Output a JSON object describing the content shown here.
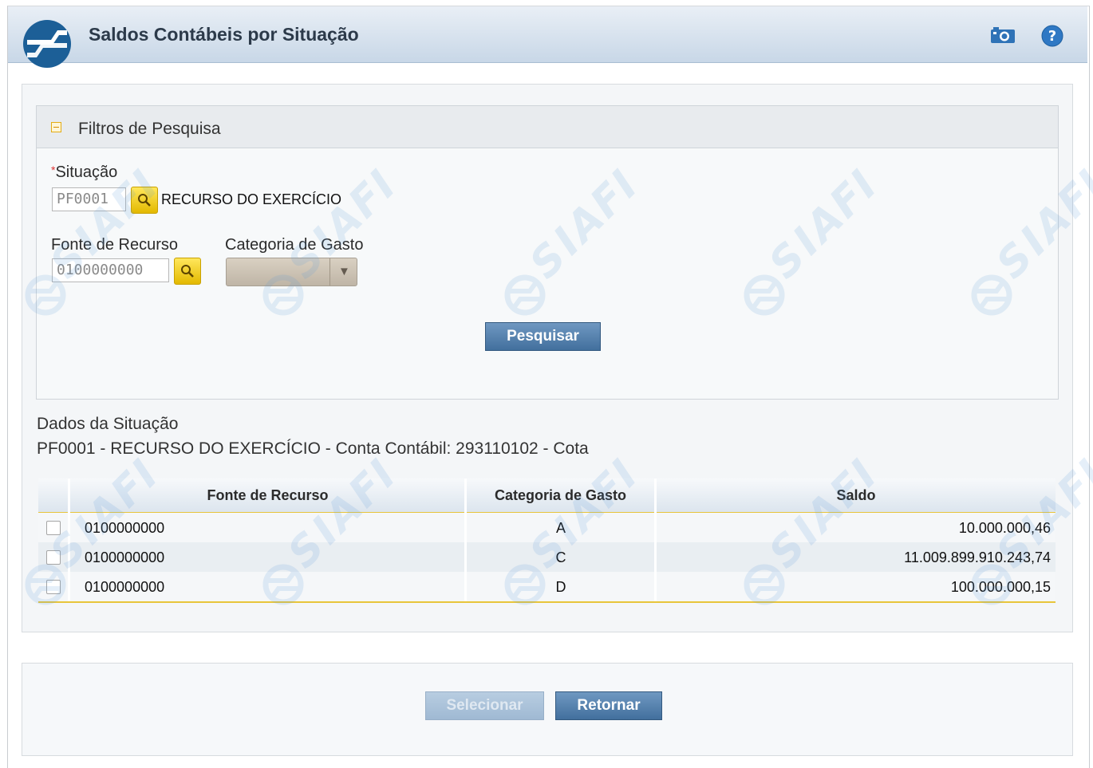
{
  "header": {
    "title": "Saldos Contábeis por Situação",
    "camera_icon": "camera-icon",
    "help_icon": "help-icon"
  },
  "filters": {
    "panel_title": "Filtros de Pesquisa",
    "situacao": {
      "label": "Situação",
      "required_mark": "*",
      "value": "PF0001",
      "description": "RECURSO DO EXERCÍCIO"
    },
    "fonte": {
      "label": "Fonte de Recurso",
      "value": "0100000000"
    },
    "categoria": {
      "label": "Categoria de Gasto",
      "value": ""
    },
    "search_button": "Pesquisar"
  },
  "situacao_data": {
    "title": "Dados da Situação",
    "line": "PF0001 - RECURSO DO EXERCÍCIO - Conta Contábil: 293110102 - Cota"
  },
  "table": {
    "columns": [
      "Fonte de Recurso",
      "Categoria de Gasto",
      "Saldo"
    ],
    "rows": [
      {
        "fonte": "0100000000",
        "categoria": "A",
        "saldo": "10.000.000,46"
      },
      {
        "fonte": "0100000000",
        "categoria": "C",
        "saldo": "11.009.899.910.243,74"
      },
      {
        "fonte": "0100000000",
        "categoria": "D",
        "saldo": "100.000.000,15"
      }
    ]
  },
  "footer": {
    "select_button": "Selecionar",
    "return_button": "Retornar"
  },
  "watermark_text": "SIAFI",
  "colors": {
    "header_gradient_top": "#e9eff6",
    "header_gradient_bottom": "#c8d7e7",
    "accent_blue": "#426f9d",
    "grid_accent": "#e8c53b",
    "lookup_yellow": "#ffe75c"
  }
}
